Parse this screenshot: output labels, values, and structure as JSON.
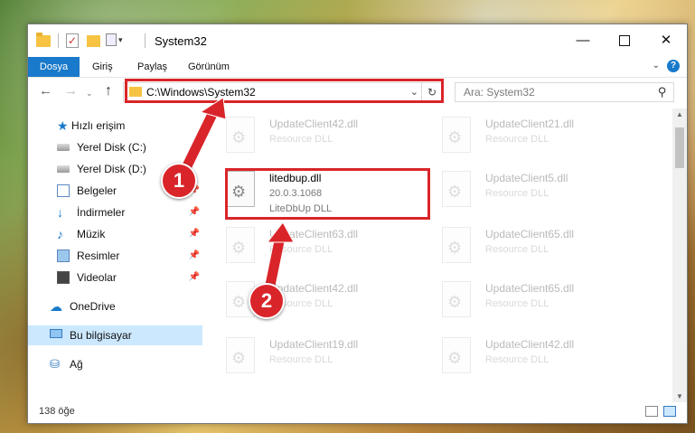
{
  "window": {
    "title": "System32",
    "min_symbol": "—",
    "close_symbol": "✕",
    "check_glyph": "✓",
    "dropdown_glyph": "▾",
    "up_glyph": "↑"
  },
  "ribbon": {
    "tabs": [
      "Dosya",
      "Giriş",
      "Paylaş",
      "Görünüm"
    ],
    "chevron": "⌄",
    "help": "?"
  },
  "nav": {
    "back": "←",
    "forward": "→",
    "recent": "⌄",
    "up": "↑",
    "address": "C:\\Windows\\System32",
    "address_drop": "⌄",
    "refresh": "↻",
    "search_placeholder": "Ara: System32",
    "search_glyph": "⚲"
  },
  "sidebar": {
    "items": [
      {
        "label": "Hızlı erişim",
        "icon": "star-icon",
        "glyph": "★"
      },
      {
        "label": "Yerel Disk (C:)",
        "icon": "drive-icon",
        "glyph": ""
      },
      {
        "label": "Yerel Disk (D:)",
        "icon": "drive-icon",
        "glyph": ""
      },
      {
        "label": "Belgeler",
        "icon": "documents-icon",
        "glyph": ""
      },
      {
        "label": "İndirmeler",
        "icon": "download-icon",
        "glyph": "↓"
      },
      {
        "label": "Müzik",
        "icon": "music-icon",
        "glyph": "♪"
      },
      {
        "label": "Resimler",
        "icon": "pictures-icon",
        "glyph": ""
      },
      {
        "label": "Videolar",
        "icon": "videos-icon",
        "glyph": ""
      },
      {
        "label": "OneDrive",
        "icon": "cloud-icon",
        "glyph": "☁"
      },
      {
        "label": "Bu bilgisayar",
        "icon": "computer-icon",
        "glyph": ""
      },
      {
        "label": "Ağ",
        "icon": "network-icon",
        "glyph": "⛁"
      }
    ],
    "pin_glyph": "📌"
  },
  "files": [
    {
      "name": "UpdateClient42.dll",
      "type": "Resource DLL",
      "version": "",
      "faded": true
    },
    {
      "name": "UpdateClient21.dll",
      "type": "Resource DLL",
      "version": "",
      "faded": true
    },
    {
      "name": "litedbup.dll",
      "version": "20.0.3.1068",
      "type": "LiteDbUp DLL",
      "faded": false
    },
    {
      "name": "UpdateClient5.dll",
      "type": "Resource DLL",
      "version": "",
      "faded": true
    },
    {
      "name": "UpdateClient63.dll",
      "type": "Resource DLL",
      "version": "",
      "faded": true
    },
    {
      "name": "UpdateClient65.dll",
      "type": "Resource DLL",
      "version": "",
      "faded": true
    },
    {
      "name": "UpdateClient42.dll",
      "type": "Resource DLL",
      "version": "",
      "faded": true
    },
    {
      "name": "UpdateClient65.dll",
      "type": "Resource DLL",
      "version": "",
      "faded": true
    },
    {
      "name": "UpdateClient19.dll",
      "type": "Resource DLL",
      "version": "",
      "faded": true
    },
    {
      "name": "UpdateClient42.dll",
      "type": "Resource DLL",
      "version": "",
      "faded": true
    }
  ],
  "scroll": {
    "up": "▲",
    "down": "▼"
  },
  "status": {
    "count": "138 öğe"
  },
  "annotations": {
    "step1": "1",
    "step2": "2"
  },
  "colors": {
    "accent": "#1979ca",
    "annotation": "#d9252a",
    "selected": "#cce8ff"
  }
}
